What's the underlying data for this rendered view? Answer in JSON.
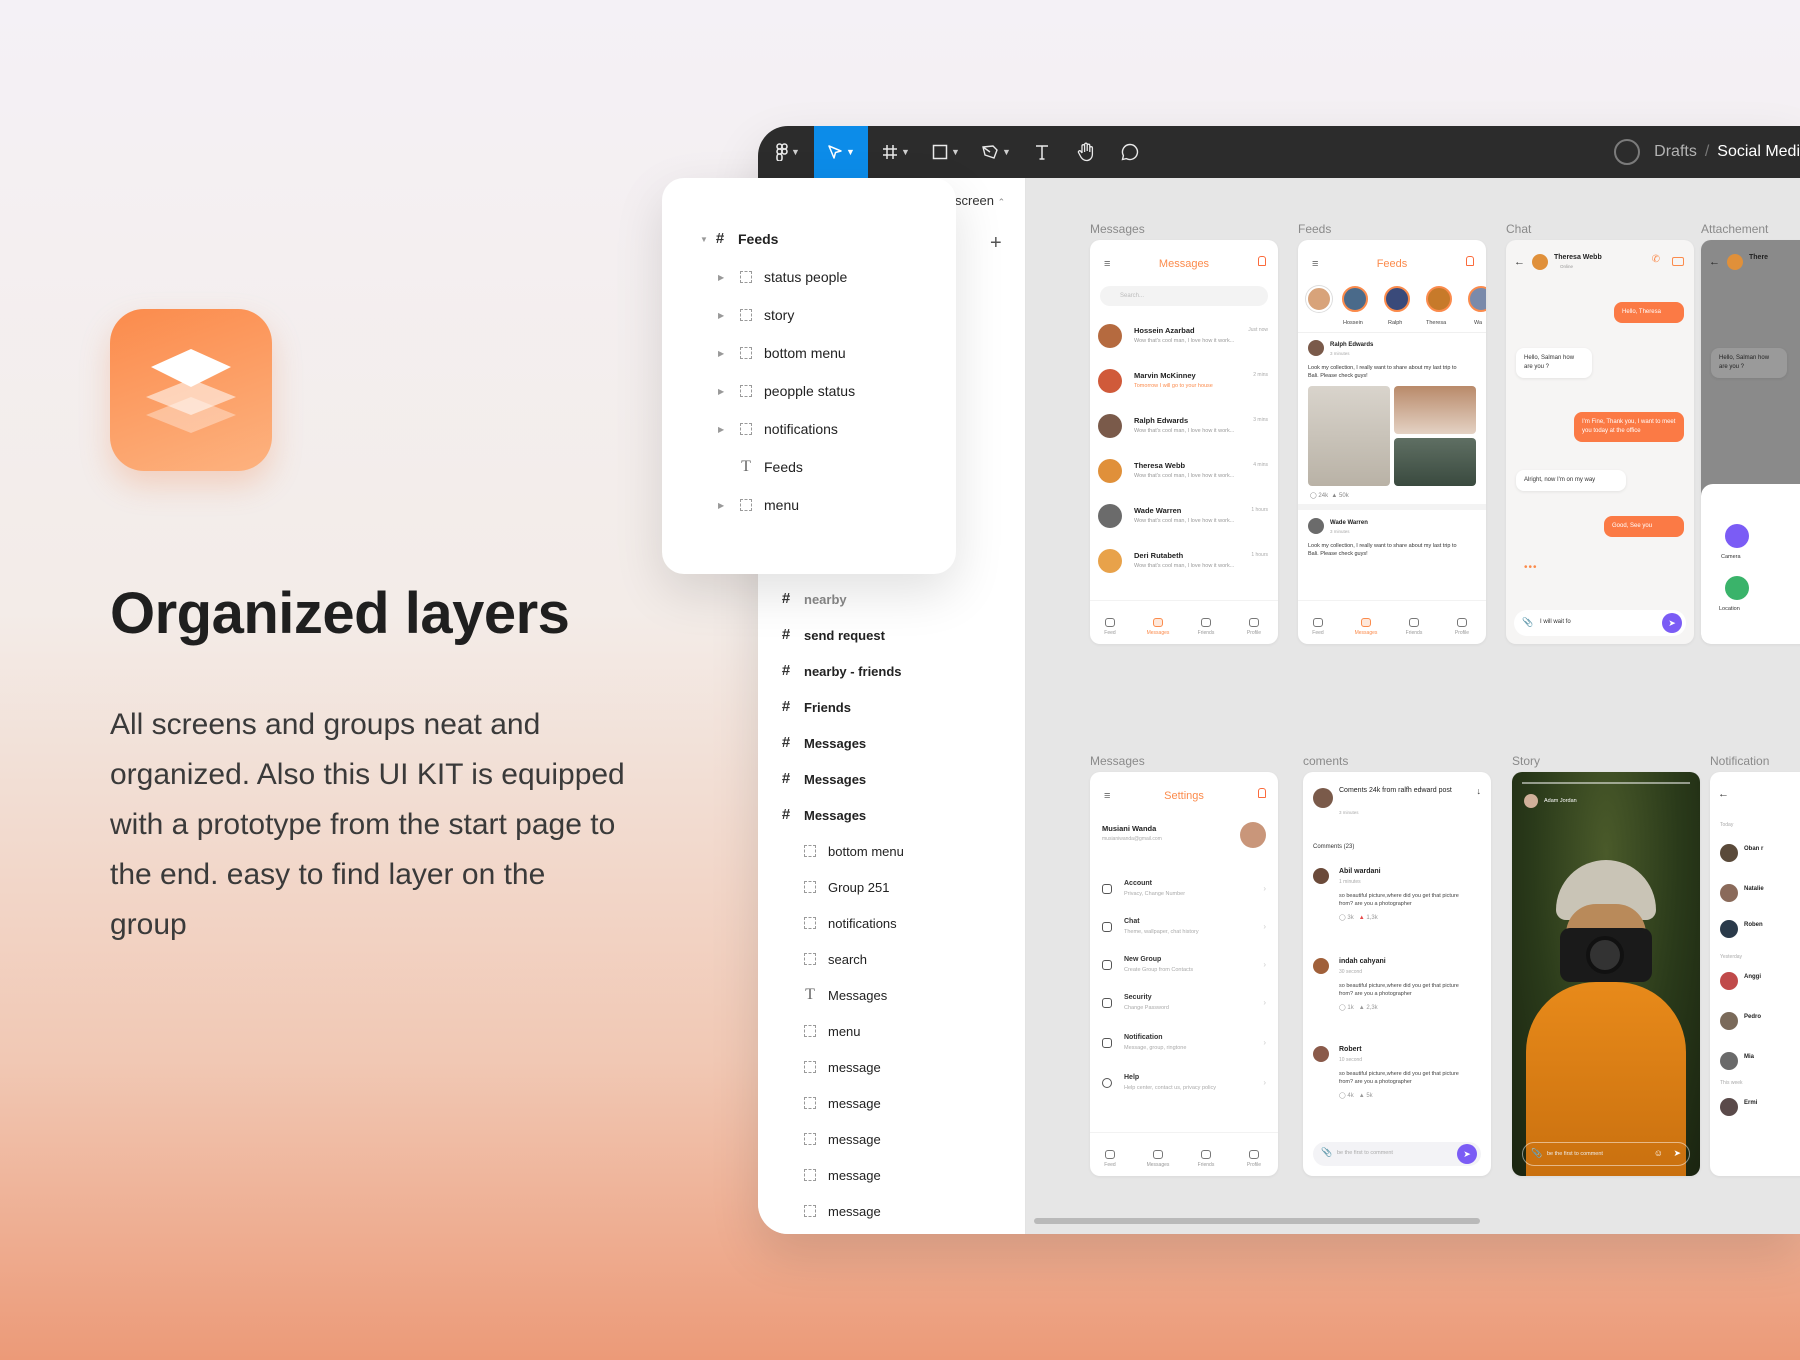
{
  "hero": {
    "title": "Organized layers",
    "body": "All screens and groups neat and organized. Also this UI KIT is equipped with a prototype from the start page to the end. easy to find layer on the group"
  },
  "toolbar": {
    "breadcrumb_drafts": "Drafts",
    "breadcrumb_sep": "/",
    "breadcrumb_file": "Social Medi"
  },
  "popover": {
    "screen_label": "screen",
    "root": "Feeds",
    "items": [
      {
        "label": "status people",
        "type": "group"
      },
      {
        "label": "story",
        "type": "group"
      },
      {
        "label": "bottom menu",
        "type": "group"
      },
      {
        "label": "peopple status",
        "type": "group"
      },
      {
        "label": "notifications",
        "type": "group"
      },
      {
        "label": "Feeds",
        "type": "text"
      },
      {
        "label": "menu",
        "type": "group"
      }
    ]
  },
  "layers": {
    "partial": "nearby",
    "frames": [
      "send request",
      "nearby - friends",
      "Friends",
      "Messages",
      "Messages",
      "Messages"
    ],
    "children": [
      {
        "label": "bottom menu",
        "type": "group"
      },
      {
        "label": "Group 251",
        "type": "group"
      },
      {
        "label": "notifications",
        "type": "group"
      },
      {
        "label": "search",
        "type": "group"
      },
      {
        "label": "Messages",
        "type": "text"
      },
      {
        "label": "menu",
        "type": "group"
      },
      {
        "label": "message",
        "type": "group"
      },
      {
        "label": "message",
        "type": "group"
      },
      {
        "label": "message",
        "type": "group"
      },
      {
        "label": "message",
        "type": "group"
      },
      {
        "label": "message",
        "type": "group"
      },
      {
        "label": "message",
        "type": "group"
      }
    ]
  },
  "canvas": {
    "frame_labels": [
      "Messages",
      "Feeds",
      "Chat",
      "Attachement",
      "Messages",
      "coments",
      "Story",
      "Notification"
    ],
    "messages_screen": {
      "title": "Messages",
      "search_placeholder": "Search...",
      "rows": [
        {
          "name": "Hossein Azarbad",
          "text": "Wow that's cool man, I love how it work...",
          "time": "Just now"
        },
        {
          "name": "Marvin McKinney",
          "text": "Tomorrow I will go to your house",
          "time": "2 mins"
        },
        {
          "name": "Ralph Edwards",
          "text": "Wow that's cool man, I love how it work...",
          "time": "3 mins"
        },
        {
          "name": "Theresa Webb",
          "text": "Wow that's cool man, I love how it work...",
          "time": "4 mins"
        },
        {
          "name": "Wade Warren",
          "text": "Wow that's cool man, I love how it work...",
          "time": "1 hours"
        },
        {
          "name": "Deri Rutabeth",
          "text": "Wow that's cool man, I love how it work...",
          "time": "1 hours"
        }
      ]
    },
    "feeds_screen": {
      "title": "Feeds",
      "stories": [
        "Hossein",
        "Ralph",
        "Theresa",
        "Wa"
      ],
      "post1_author": "Ralph Edwards",
      "post1_time": "3 minutes",
      "post1_text": "Look my collection, I really want to share about my last trip to Bali. Please check guys!",
      "post1_comments": "24k",
      "post1_likes": "50k",
      "post2_author": "Wade Warren",
      "post2_time": "3 minutes",
      "post2_text": "Look my collection, I really want to share about my last trip to Bali. Please check guys!"
    },
    "chat_screen": {
      "contact": "Theresa Webb",
      "status": "Online",
      "b1": "Hello, Theresa",
      "b2": "Hello, Salman how are you ?",
      "b3": "I'm Fine, Thank you, I want to meet you today at the office",
      "b4": "Alright, now I'm on my way",
      "b5": "Good, See you",
      "input": "I will wait fo"
    },
    "attach_screen": {
      "contact": "There",
      "b2": "Hello, Salman how are you ?",
      "camera": "Camera",
      "location": "Location"
    },
    "settings_screen": {
      "title": "Settings",
      "user": "Musiani Wanda",
      "email": "musianiwanda@gmail.com",
      "rows": [
        {
          "t": "Account",
          "s": "Privacy, Change Number"
        },
        {
          "t": "Chat",
          "s": "Theme, wallpaper, chat history"
        },
        {
          "t": "New Group",
          "s": "Create Group from Contacts"
        },
        {
          "t": "Security",
          "s": "Change Password"
        },
        {
          "t": "Notification",
          "s": "Message, group, ringtone"
        },
        {
          "t": "Help",
          "s": "Help center, contact us, privacy policy"
        }
      ]
    },
    "comments_screen": {
      "header": "Coments 24k from ralfh edward post",
      "header_time": "3 minutes",
      "count": "Comments (23)",
      "items": [
        {
          "n": "Abil wardani",
          "d": "1 minutes",
          "b": "so beautiful picture,where did you get that picture from? are you a photographer",
          "c": "3k",
          "l": "1,3k"
        },
        {
          "n": "indah cahyani",
          "d": "30 second",
          "b": "so beautiful picture,where did you get that picture from? are you a photographer",
          "c": "1k",
          "l": "2,3k"
        },
        {
          "n": "Robert",
          "d": "10 second",
          "b": "so beautiful picture,where did you get that picture from? are you a photographer",
          "c": "4k",
          "l": "5k"
        }
      ],
      "input": "be the first to comment"
    },
    "story_screen": {
      "author": "Adam Jordan",
      "input": "be the first to comment"
    },
    "notif_screen": {
      "today": "Today",
      "yesterday": "Yesterday",
      "this_week": "This week",
      "names": [
        "Oban r",
        "Natalie",
        "Roben",
        "Anggi",
        "Pedro",
        "Mia",
        "Ermi"
      ]
    },
    "tabs": [
      "Feed",
      "Messages",
      "Friends",
      "Profile"
    ]
  },
  "colors": {
    "accent": "#fb8b4c",
    "selection": "#0c8ce9",
    "toolbar": "#2c2c2c"
  }
}
